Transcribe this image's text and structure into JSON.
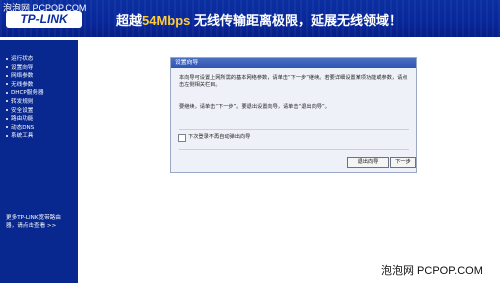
{
  "header": {
    "watermark": "泡泡网 PCPOP.COM",
    "logo": "TP-LINK",
    "slogan_prefix": "超越",
    "slogan_speed": "54Mbps",
    "slogan_rest": " 无线传输距离极限，延展无线领域！",
    "banner_color": "#0a2fa0"
  },
  "sidebar": {
    "items": [
      {
        "label": "运行状态"
      },
      {
        "label": "设置向导"
      },
      {
        "label": "网络参数"
      },
      {
        "label": "无线参数"
      },
      {
        "label": "DHCP服务器"
      },
      {
        "label": "转发规则"
      },
      {
        "label": "安全设置"
      },
      {
        "label": "路由功能"
      },
      {
        "label": "动态DNS"
      },
      {
        "label": "系统工具"
      }
    ],
    "more_line1": "更多TP-LINK宽带路由",
    "more_line2": "器，请点击查看 >>"
  },
  "wizard": {
    "title": "设置向导",
    "para1": "本向导可设置上网所需的基本网络参数，请单击“下一步”继续。若要详细设置某项功能或参数，请点击左侧相关栏目。",
    "para2": "要继续，请单击“下一步”。要退出设置向导，请单击“退出向导”。",
    "checkbox_label": "下次登录不再自动弹出向导",
    "exit_button": "退出向导",
    "next_button": "下一步"
  },
  "footer": {
    "watermark": "泡泡网 PCPOP.COM"
  }
}
